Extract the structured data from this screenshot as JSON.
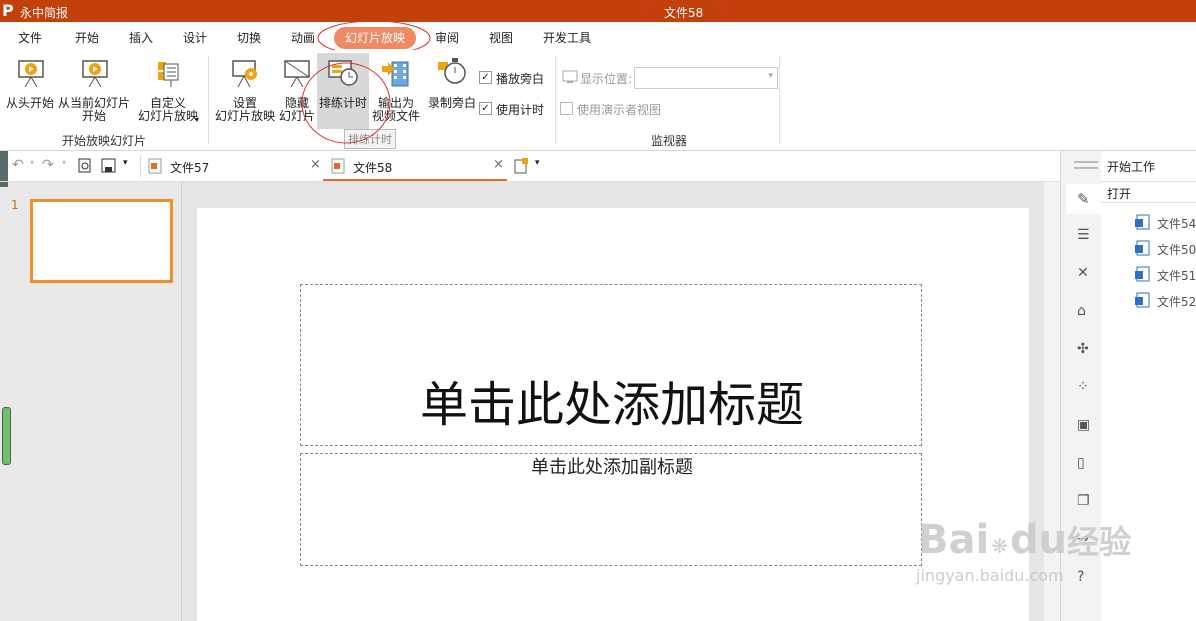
{
  "app": {
    "name": "永中简报",
    "document_title": "文件58",
    "logo_letter": "P"
  },
  "menu": {
    "items": [
      "文件",
      "开始",
      "插入",
      "设计",
      "切换",
      "动画",
      "幻灯片放映",
      "审阅",
      "视图",
      "开发工具"
    ],
    "active": "幻灯片放映"
  },
  "ribbon": {
    "group1": {
      "label": "开始放映幻灯片",
      "btn_from_start": "从头开始",
      "btn_from_current_1": "从当前幻灯片",
      "btn_from_current_2": "开始",
      "btn_custom_1": "自定义",
      "btn_custom_2": "幻灯片放映"
    },
    "group2": {
      "btn_setup_1": "设置",
      "btn_setup_2": "幻灯片放映",
      "btn_hide_1": "隐藏",
      "btn_hide_2": "幻灯片",
      "btn_rehearse": "排练计时",
      "btn_export_1": "输出为",
      "btn_export_2": "视频文件",
      "btn_record": "录制旁白",
      "chk_narration": "播放旁白",
      "chk_timing": "使用计时",
      "tooltip": "排练计时"
    },
    "group3": {
      "label": "监视器",
      "display_label": "显示位置:",
      "presenter_view": "使用演示者视图"
    }
  },
  "tabs": [
    {
      "label": "文件57"
    },
    {
      "label": "文件58"
    }
  ],
  "slides": {
    "number": "1"
  },
  "slide": {
    "title_placeholder": "单击此处添加标题",
    "subtitle_placeholder": "单击此处添加副标题"
  },
  "right_pane": {
    "header": "开始工作",
    "open_label": "打开",
    "files": [
      "文件54",
      "文件50",
      "文件51",
      "文件52"
    ]
  },
  "watermark": {
    "line1": "Bai",
    "line2": "du",
    "line3": "经验",
    "url": "jingyan.baidu.com"
  },
  "colors": {
    "accent": "#c3400a",
    "active_tab": "#f08a64",
    "selected_thumb": "#f0902a",
    "file_icon": "#2f6fbf"
  }
}
